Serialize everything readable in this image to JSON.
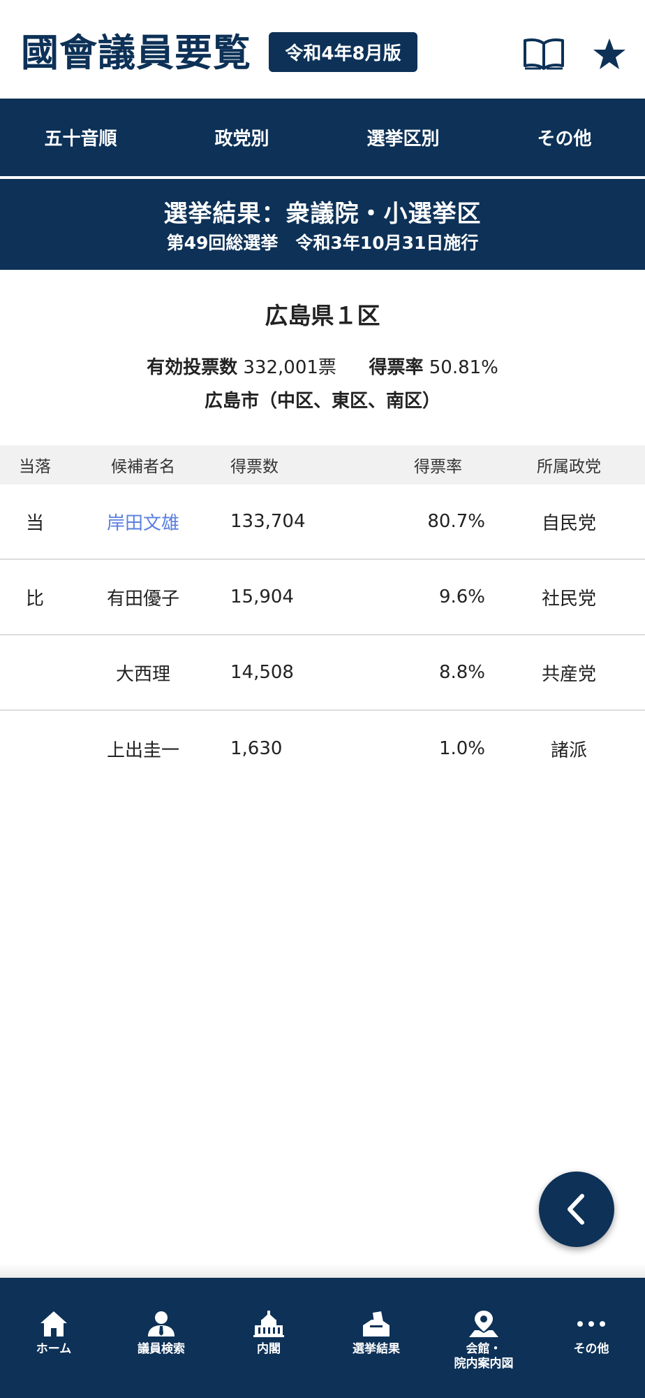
{
  "header": {
    "title": "國會議員要覧",
    "edition": "令和4年8月版",
    "book_icon": "book-open-icon",
    "star_icon": "star-icon"
  },
  "nav_tabs": [
    {
      "label": "五十音順"
    },
    {
      "label": "政党別"
    },
    {
      "label": "選挙区別"
    },
    {
      "label": "その他"
    }
  ],
  "banner": {
    "title": "選挙結果：衆議院・小選挙区",
    "subtitle": "第49回総選挙　令和3年10月31日施行"
  },
  "district": {
    "name": "広島県１区",
    "valid_votes_label": "有効投票数",
    "valid_votes": "332,001票",
    "turnout_label": "得票率",
    "turnout": "50.81%",
    "area": "広島市（中区、東区、南区）"
  },
  "table": {
    "headers": [
      "当落",
      "候補者名",
      "得票数",
      "得票率",
      "所属政党"
    ],
    "rows": [
      {
        "result": "当",
        "name": "岸田文雄",
        "votes": "133,704",
        "rate": "80.7%",
        "party": "自民党"
      },
      {
        "result": "比",
        "name": "有田優子",
        "votes": "15,904",
        "rate": "9.6%",
        "party": "社民党"
      },
      {
        "result": "",
        "name": "大西理",
        "votes": "14,508",
        "rate": "8.8%",
        "party": "共産党"
      },
      {
        "result": "",
        "name": "上出圭一",
        "votes": "1,630",
        "rate": "1.0%",
        "party": "諸派"
      }
    ]
  },
  "fab": {
    "icon": "chevron-left-icon"
  },
  "bottom_nav": [
    {
      "label": "ホーム",
      "icon": "home-icon"
    },
    {
      "label": "議員検索",
      "icon": "person-search-icon"
    },
    {
      "label": "内閣",
      "icon": "diet-building-icon"
    },
    {
      "label": "選挙結果",
      "icon": "ballot-box-icon"
    },
    {
      "label": "会館・\n院内案内図",
      "icon": "map-pin-icon"
    },
    {
      "label": "その他",
      "icon": "more-dots-icon"
    }
  ],
  "colors": {
    "primary": "#0d3157",
    "link": "#5a7fe0",
    "header_row_bg": "#f1f1f1"
  }
}
